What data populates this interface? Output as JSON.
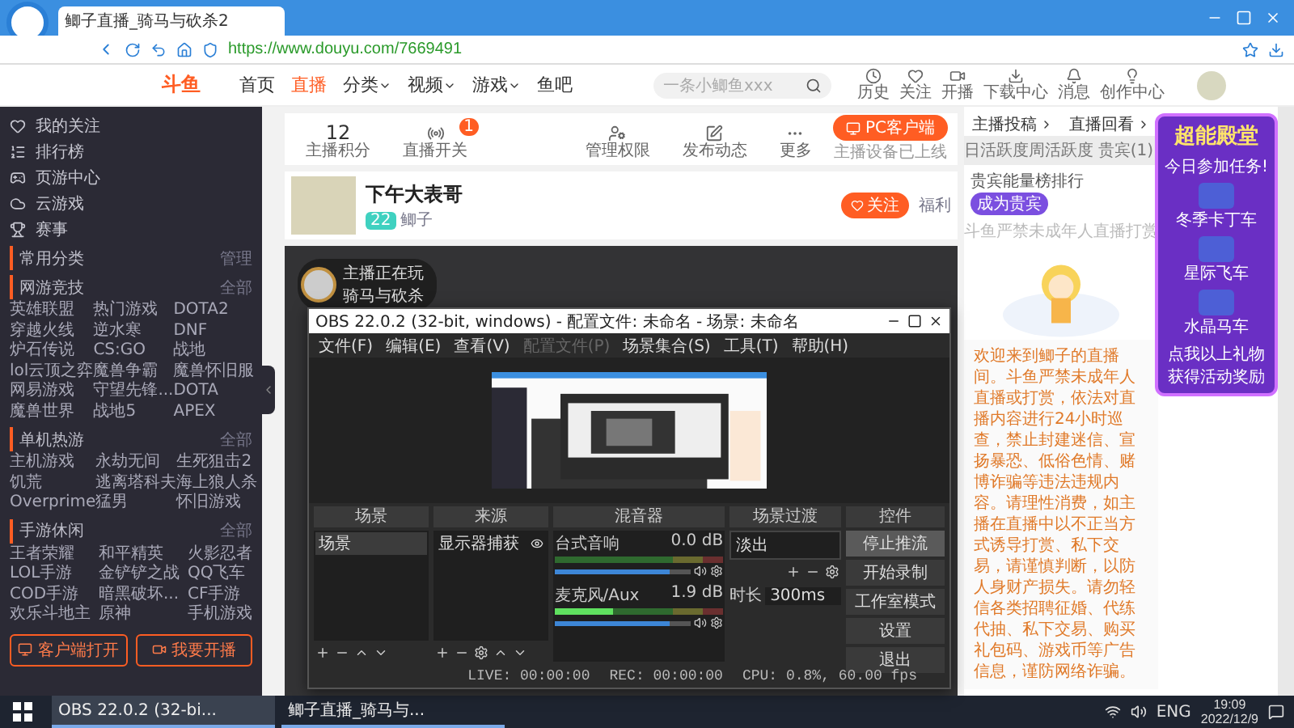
{
  "browser": {
    "tab_title": "鲫子直播_骑马与砍杀2",
    "url": "https://www.douyu.com/7669491"
  },
  "site": {
    "logo": "斗鱼",
    "nav": [
      {
        "label": "首页",
        "selected": false,
        "dropdown": false
      },
      {
        "label": "直播",
        "selected": true,
        "dropdown": false
      },
      {
        "label": "分类",
        "selected": false,
        "dropdown": true
      },
      {
        "label": "视频",
        "selected": false,
        "dropdown": true
      },
      {
        "label": "游戏",
        "selected": false,
        "dropdown": true
      },
      {
        "label": "鱼吧",
        "selected": false,
        "dropdown": false
      }
    ],
    "search": {
      "placeholder": "一条小鲫鱼xxx"
    },
    "header_links": [
      "历史",
      "关注",
      "开播",
      "下载中心",
      "消息",
      "创作中心"
    ]
  },
  "sidebar": {
    "items": [
      "我的关注",
      "排行榜",
      "页游中心",
      "云游戏",
      "赛事"
    ],
    "common": {
      "title": "常用分类",
      "action": "管理"
    },
    "sections": [
      {
        "title": "网游竞技",
        "more": "全部",
        "games": [
          "英雄联盟",
          "热门游戏",
          "DOTA2",
          "穿越火线",
          "逆水寒",
          "DNF",
          "炉石传说",
          "CS:GO",
          "战地",
          "lol云顶之弈",
          "魔兽争霸",
          "魔兽怀旧服",
          "网易游戏",
          "守望先锋...",
          "DOTA",
          "魔兽世界",
          "战地5",
          "APEX"
        ]
      },
      {
        "title": "单机热游",
        "more": "全部",
        "games": [
          "主机游戏",
          "永劫无间",
          "生死狙击2",
          "饥荒",
          "逃离塔科夫",
          "海上狼人杀",
          "Overprime",
          "猛男",
          "怀旧游戏"
        ]
      },
      {
        "title": "手游休闲",
        "more": "全部",
        "games": [
          "王者荣耀",
          "和平精英",
          "火影忍者",
          "LOL手游",
          "金铲铲之战",
          "QQ飞车",
          "COD手游",
          "暗黑破坏...",
          "CF手游",
          "欢乐斗地主",
          "原神",
          "手机游戏"
        ]
      }
    ],
    "buttons": [
      "客户端打开",
      "我要开播"
    ]
  },
  "toolbar": {
    "items": [
      {
        "value": "12",
        "label": "主播积分"
      },
      {
        "label": "直播开关",
        "badge": "1"
      },
      {
        "label": "管理权限"
      },
      {
        "label": "发布动态"
      },
      {
        "label": "更多"
      }
    ],
    "pc_button": "PC客户端",
    "pc_note": "主播设备已上线"
  },
  "streamer": {
    "title": "下午大表哥",
    "level": "22",
    "name": "鲫子",
    "follow": "关注",
    "extra": "福利"
  },
  "video": {
    "badge_title": "主播正在玩",
    "badge_game": "骑马与砍杀"
  },
  "right_panel": {
    "links": [
      "主播投稿",
      "直播回看"
    ],
    "tabs": [
      {
        "label": "日活跃度",
        "selected": false
      },
      {
        "label": "周活跃度",
        "selected": false
      },
      {
        "label": "贵宾(1)",
        "selected": false
      }
    ],
    "rank_title": "贵宾能量榜排行",
    "vip_button": "成为贵宾",
    "empty_caption": "斗鱼严禁未成年人直播打赏",
    "notice": "欢迎来到鲫子的直播间。斗鱼严禁未成年人直播或打赏，依法对直播内容进行24小时巡查，禁止封建迷信、宣扬暴恐、低俗色情、赌博诈骗等违法违规内容。请理性消费，如主播在直播中以不正当方式诱导打赏、私下交易，请谨慎判断，以防人身财产损失。请勿轻信各类招聘征婚、代练代抽、私下交易、购买礼包码、游戏币等广告信息，谨防网络诈骗。"
  },
  "promo": {
    "title": "超能殿堂",
    "subtitle": "今日参加任务!",
    "items": [
      "冬季卡丁车",
      "星际飞车",
      "水晶马车"
    ],
    "footer": "点我以上礼物获得活动奖励"
  },
  "obs": {
    "title": "OBS 22.0.2 (32-bit, windows) - 配置文件: 未命名 - 场景: 未命名",
    "menu": [
      {
        "label": "文件(F)",
        "disabled": false
      },
      {
        "label": "编辑(E)",
        "disabled": false
      },
      {
        "label": "查看(V)",
        "disabled": false
      },
      {
        "label": "配置文件(P)",
        "disabled": true
      },
      {
        "label": "场景集合(S)",
        "disabled": false
      },
      {
        "label": "工具(T)",
        "disabled": false
      },
      {
        "label": "帮助(H)",
        "disabled": false
      }
    ],
    "docks": [
      "场景",
      "来源",
      "混音器",
      "场景过渡",
      "控件"
    ],
    "scenes": [
      {
        "label": "场景",
        "selected": true
      }
    ],
    "sources": [
      {
        "label": "显示器捕获",
        "visible": true
      }
    ],
    "mixer": [
      {
        "name": "台式音响",
        "reading": "0.0 dB",
        "volume": {
          "level": 0.85
        }
      },
      {
        "name": "麦克风/Aux",
        "reading": "1.9 dB",
        "meter": {
          "level": 0.35
        },
        "volume": {
          "level": 0.85
        }
      }
    ],
    "transition": {
      "value": "淡出",
      "duration_label": "时长",
      "duration": "300ms"
    },
    "controls": [
      {
        "label": "停止推流",
        "highlighted": true
      },
      {
        "label": "开始录制",
        "highlighted": false
      },
      {
        "label": "工作室模式",
        "highlighted": false
      },
      {
        "label": "设置",
        "highlighted": false
      },
      {
        "label": "退出",
        "highlighted": false
      }
    ],
    "status": [
      "LIVE: 00:00:00",
      "REC: 00:00:00",
      "CPU: 0.8%, 60.00 fps"
    ]
  },
  "taskbar": {
    "apps": [
      {
        "label": "OBS 22.0.2 (32-bi...",
        "active": true
      },
      {
        "label": "鲫子直播_骑马与...",
        "active": false
      }
    ],
    "language": "ENG",
    "time": "19:09",
    "date": "2022/12/9"
  }
}
